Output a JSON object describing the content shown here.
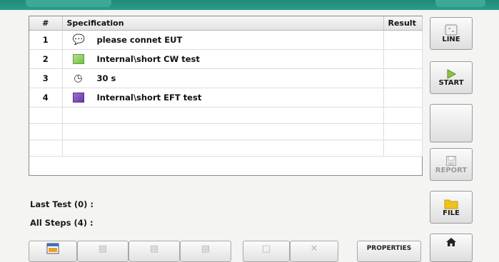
{
  "table": {
    "headers": {
      "num": "#",
      "spec": "Specification",
      "result": "Result"
    },
    "rows": [
      {
        "num": "1",
        "icon": "speech-bubble-icon",
        "spec": "please connet EUT",
        "result": ""
      },
      {
        "num": "2",
        "icon": "cw-test-icon",
        "spec": "Internal\\short CW test",
        "result": ""
      },
      {
        "num": "3",
        "icon": "timer-icon",
        "spec": "30 s",
        "result": ""
      },
      {
        "num": "4",
        "icon": "eft-test-icon",
        "spec": "Internal\\short EFT test",
        "result": ""
      }
    ]
  },
  "summary": {
    "last_test": "Last Test (0) :",
    "all_steps": "All Steps (4) :"
  },
  "side_buttons": {
    "line": "LINE",
    "start": "START",
    "report": "REPORT",
    "file": "FILE"
  },
  "bottom_bar": {
    "properties": "PROPERTIES"
  },
  "colors": {
    "accent_teal": "#2b9c88",
    "start_green": "#8bc63e",
    "file_yellow": "#f2c21a"
  }
}
